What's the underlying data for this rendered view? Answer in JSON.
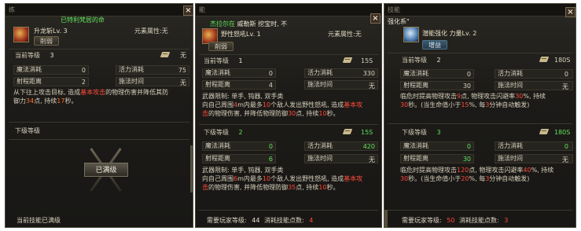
{
  "panel1": {
    "header_strip": "已特利梵居的命",
    "skill_name": "升龙斩Lv. 3",
    "element_label": "元素属性:无",
    "tag": "削弱",
    "current_level_label": "当前等级",
    "current_level_value": "3",
    "current_level_right": "无",
    "mana_label": "魔法消耗",
    "mana_value": "0",
    "vigor_label": "活力消耗",
    "vigor_value": "75",
    "range_label": "射程距离",
    "range_value": "2",
    "cast_label": "施法时间",
    "cast_value": "无",
    "desc_1": "从下往上攻击目标, 造成",
    "desc_hl_1": "基本攻击",
    "desc_2": "的物理伤害并降低其防",
    "desc_3": "御力",
    "desc_hl_2": "34",
    "desc_4": "点, 持续",
    "desc_hl_3": "17",
    "desc_5": "秒。",
    "next_level_label": "下级等级",
    "max_badge": "已满级",
    "footer": "当前技能已满级"
  },
  "panel2": {
    "top_label": "能",
    "header_strip_green": "杰拉尔在",
    "header_strip_white": "威勒斯  挖宝时, 不",
    "skill_name": "野性怒吼Lv. 1",
    "element_label": "元素属性:无",
    "tag": "削弱",
    "current_level_label": "当前等级",
    "current_level_value": "1",
    "current_level_right": "15S",
    "mana_label": "魔法消耗",
    "mana_value": "0",
    "vigor_label": "活力消耗",
    "vigor_value": "330",
    "range_label": "射程距离",
    "range_value": "4",
    "cast_label": "施法时间",
    "cast_value": "无",
    "weapons": "武器限制: 单手, 钝器, 双手类",
    "desc_1": "向自己周围",
    "desc_hl_1": "4",
    "desc_2": "m内最多",
    "desc_hl_2": "10",
    "desc_3": "个敌人发出野性怒吼, 造成",
    "desc_hl_3": "基本攻",
    "desc_4": "击",
    "desc_5": "的物理伤害, 并降低物理防御",
    "desc_hl_4": "30",
    "desc_6": "点, 持续",
    "desc_hl_5": "10",
    "desc_7": "秒。",
    "next_level_label": "下级等级",
    "next_level_value": "2",
    "next_level_right": "15S",
    "next_mana_value": "0",
    "next_vigor_value": "420",
    "next_range_value": "6",
    "next_cast_value": "无",
    "next_weapons": "武器限制: 单手, 钝器, 双手类",
    "next_desc_1": "向自己周围",
    "next_desc_hl_1": "6",
    "next_desc_2": "m内最多",
    "next_desc_hl_2": "10",
    "next_desc_3": "个敌人发出野性怒吼, 造成",
    "next_desc_hl_3": "基本攻",
    "next_desc_4": "击",
    "next_desc_5": "的物理伤害, 并降低物理防御",
    "next_desc_hl_4": "35",
    "next_desc_6": "点, 持续",
    "next_desc_hl_5": "10",
    "next_desc_7": "秒。",
    "footer_label": "需要玩家等级:",
    "footer_level": "44",
    "footer_points_label": "消耗技能点数:",
    "footer_points": "4"
  },
  "panel3": {
    "top_label": "技能",
    "header_strip": "强化系\"",
    "skill_name": "潜能强化 力量Lv. 2",
    "tag": "增益",
    "current_level_label": "当前等级",
    "current_level_value": "2",
    "current_level_right": "180S",
    "mana_label": "魔法消耗",
    "mana_value": "0",
    "vigor_label": "活力消耗",
    "vigor_value": "0",
    "range_label": "射程距离",
    "range_value": "30",
    "cast_label": "施法时间",
    "cast_value": "无",
    "desc_1": "临危时提高物理攻击",
    "desc_hl_1": "9",
    "desc_2": "点, 物理攻击闪避率",
    "desc_hl_2": "30",
    "desc_3": "%, 持续",
    "desc_hl_3": "30",
    "desc_4": "秒。(当生命值小于",
    "desc_hl_4": "15",
    "desc_5": "%, 每",
    "desc_hl_5": "3",
    "desc_6": "分钟自动触发)",
    "next_level_label": "下级等级",
    "next_level_value": "3",
    "next_level_right": "180S",
    "next_mana_value": "0",
    "next_vigor_value": "0",
    "next_range_value": "30",
    "next_cast_value": "无",
    "next_desc_1": "临危时提高物理攻击",
    "next_desc_hl_1": "120",
    "next_desc_2": "点, 物理攻击闪避率",
    "next_desc_hl_2": "40",
    "next_desc_3": "%, 持续",
    "next_desc_hl_3": "30",
    "next_desc_4": "秒。(当生命值小于",
    "next_desc_hl_4": "20",
    "next_desc_5": "%, 每",
    "next_desc_hl_5": "3",
    "next_desc_6": "分钟自动触发)",
    "footer_label": "需要玩家等级:",
    "footer_level": "50",
    "footer_points_label": "消耗技能点数:",
    "footer_points": "3"
  },
  "colors": {
    "highlight_red": "#ff4a3a",
    "highlight_green": "#5fe35a",
    "highlight_orange": "#ff6b2d",
    "panel_bg": "#1c1b18"
  },
  "icons": [
    "close-icon",
    "scroll-icon",
    "crossed-swords-icon",
    "skill-icon"
  ]
}
